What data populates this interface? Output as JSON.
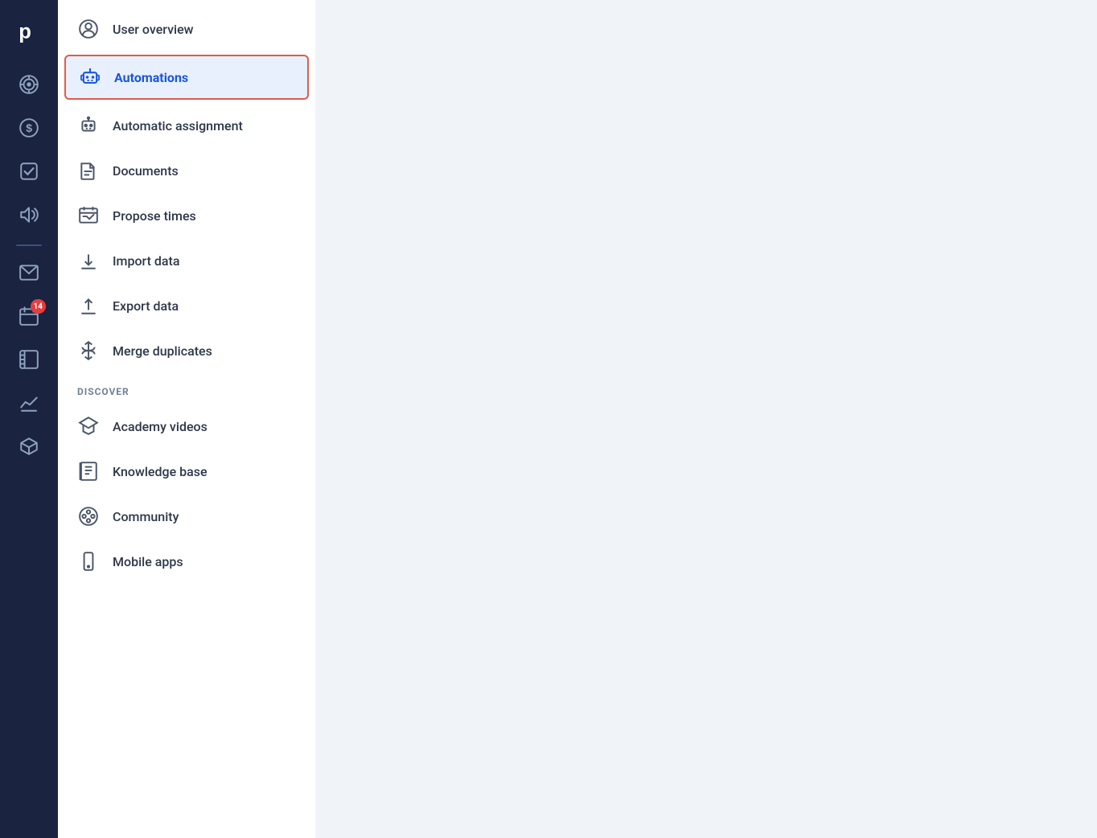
{
  "app": {
    "logo_letter": "p"
  },
  "sidebar": {
    "icons": [
      {
        "name": "target-icon",
        "label": "Target/Goals",
        "active": false
      },
      {
        "name": "dollar-icon",
        "label": "Finance",
        "active": false
      },
      {
        "name": "checkbox-icon",
        "label": "Tasks",
        "active": false
      },
      {
        "name": "megaphone-icon",
        "label": "Announcements",
        "active": false
      },
      {
        "name": "email-icon",
        "label": "Email",
        "active": false
      },
      {
        "name": "calendar-icon",
        "label": "Calendar",
        "active": false,
        "badge": "14"
      },
      {
        "name": "contacts-icon",
        "label": "Contacts",
        "active": false
      },
      {
        "name": "chart-icon",
        "label": "Reports",
        "active": false
      },
      {
        "name": "box-icon",
        "label": "Products",
        "active": false
      }
    ]
  },
  "menu": {
    "items": [
      {
        "id": "user-overview",
        "label": "User overview",
        "icon": "user-circle-icon"
      },
      {
        "id": "automations",
        "label": "Automations",
        "icon": "robot-icon",
        "active": true
      }
    ],
    "sub_items": [
      {
        "id": "automatic-assignment",
        "label": "Automatic assignment",
        "icon": "assignment-icon"
      },
      {
        "id": "documents",
        "label": "Documents",
        "icon": "document-icon"
      },
      {
        "id": "propose-times",
        "label": "Propose times",
        "icon": "propose-times-icon"
      },
      {
        "id": "import-data",
        "label": "Import data",
        "icon": "import-icon"
      },
      {
        "id": "export-data",
        "label": "Export data",
        "icon": "export-icon"
      },
      {
        "id": "merge-duplicates",
        "label": "Merge duplicates",
        "icon": "merge-icon"
      }
    ],
    "discover_section": "DISCOVER",
    "discover_items": [
      {
        "id": "academy-videos",
        "label": "Academy videos",
        "icon": "graduation-icon"
      },
      {
        "id": "knowledge-base",
        "label": "Knowledge base",
        "icon": "knowledge-icon"
      },
      {
        "id": "community",
        "label": "Community",
        "icon": "community-icon"
      },
      {
        "id": "mobile-apps",
        "label": "Mobile apps",
        "icon": "mobile-icon"
      }
    ]
  }
}
